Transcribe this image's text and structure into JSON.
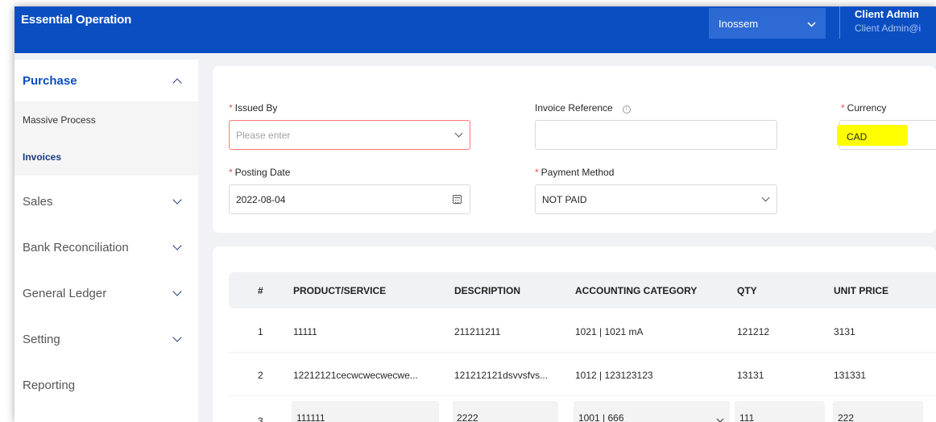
{
  "header": {
    "app_title": "Essential Operation",
    "company": "Inossem",
    "user_name": "Client Admin",
    "user_email": "Client Admin@i"
  },
  "sidebar": {
    "sections": [
      {
        "label": "Purchase",
        "expanded": true,
        "sub_items": [
          "Massive Process",
          "Invoices"
        ]
      },
      {
        "label": "Sales"
      },
      {
        "label": "Bank Reconciliation"
      },
      {
        "label": "General Ledger"
      },
      {
        "label": "Setting"
      },
      {
        "label": "Reporting"
      }
    ],
    "active_sub_item": "Invoices"
  },
  "form": {
    "issued_by": {
      "label": "Issued By",
      "required": true,
      "placeholder": "Please enter",
      "value": ""
    },
    "invoice_reference": {
      "label": "Invoice Reference",
      "required": false,
      "value": ""
    },
    "currency": {
      "label": "Currency",
      "required": true,
      "value": "CAD"
    },
    "posting_date": {
      "label": "Posting Date",
      "required": true,
      "value": "2022-08-04"
    },
    "payment_method": {
      "label": "Payment Method",
      "required": true,
      "value": "NOT PAID"
    },
    "required_mark": "*",
    "info_glyph": "i"
  },
  "table": {
    "headers": [
      "#",
      "PRODUCT/SERVICE",
      "DESCRIPTION",
      "ACCOUNTING CATEGORY",
      "QTY",
      "UNIT PRICE"
    ],
    "rows": [
      [
        "1",
        "11111",
        "211211211",
        "1021 | 1021 mA",
        "121212",
        "3131"
      ],
      [
        "2",
        "12212121cecwcwecwecwe...",
        "121212121dsvvsfvs...",
        "1012 | 123123123",
        "13131",
        "131331"
      ],
      [
        "3",
        "111111",
        "2222",
        "1001 | 666",
        "111",
        "222"
      ]
    ]
  },
  "colors": {
    "header_bg": "#0a4ec2",
    "accent": "#0a4ec2",
    "error_border": "#ff7875",
    "highlight": "#ffff00"
  },
  "icons": {
    "company_select": "chevron-down-icon",
    "sidebar_expanded": "chevron-up-icon",
    "sidebar_collapsed": "chevron-down-icon",
    "date": "calendar-icon",
    "info": "info-icon"
  }
}
